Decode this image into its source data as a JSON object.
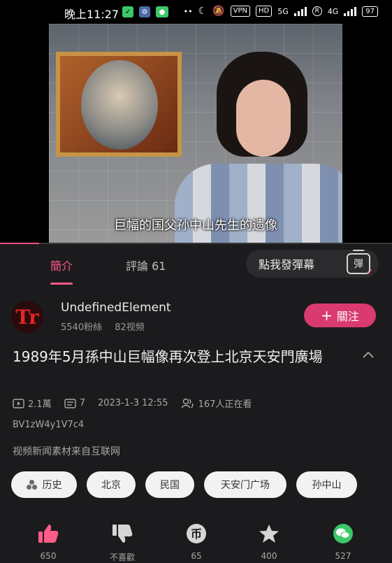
{
  "status_bar": {
    "time": "晚上11:27",
    "vpn": "VPN",
    "hd": "HD",
    "net1": "5G",
    "net2": "4G",
    "battery": "97"
  },
  "video": {
    "subtitle": "巨幅的国父孙中山先生的遗像",
    "progress": 0.1
  },
  "tabs": {
    "intro": "簡介",
    "comments": "評論 61"
  },
  "danmaku": {
    "label": "點我發彈幕",
    "icon_text": "彈"
  },
  "uploader": {
    "avatar_text": "Tr",
    "name": "UndefinedElement",
    "fans": "5540粉絲",
    "videos": "82视频",
    "follow_label": "關注",
    "follow_plus": "+"
  },
  "video_info": {
    "title": "1989年5月孫中山巨幅像再次登上北京天安門廣場",
    "views": "2.1萬",
    "danmaku_count": "7",
    "date": "2023-1-3 12:55",
    "watching": "167人正在看",
    "bvid": "BV1zW4y1V7c4",
    "description": "视频新闻素材来自互联网"
  },
  "tags": [
    "历史",
    "北京",
    "民国",
    "天安门广场",
    "孙中山"
  ],
  "actions": {
    "like": "650",
    "dislike": "不喜歡",
    "coin": "65",
    "favorite": "400",
    "share": "527"
  },
  "colors": {
    "accent": "#ff5c8a",
    "follow_bg": "#d93a70",
    "wechat": "#3cc76a",
    "bg": "#1b1b1d"
  },
  "icons": [
    "shield-icon",
    "gear-icon",
    "wechat-icon",
    "moon-icon",
    "mute-icon",
    "signal-icon",
    "battery-icon",
    "play-icon",
    "danmaku-icon",
    "watching-icon",
    "chevron-up-icon",
    "like-icon",
    "dislike-icon",
    "coin-icon",
    "star-icon",
    "wechat-share-icon"
  ]
}
